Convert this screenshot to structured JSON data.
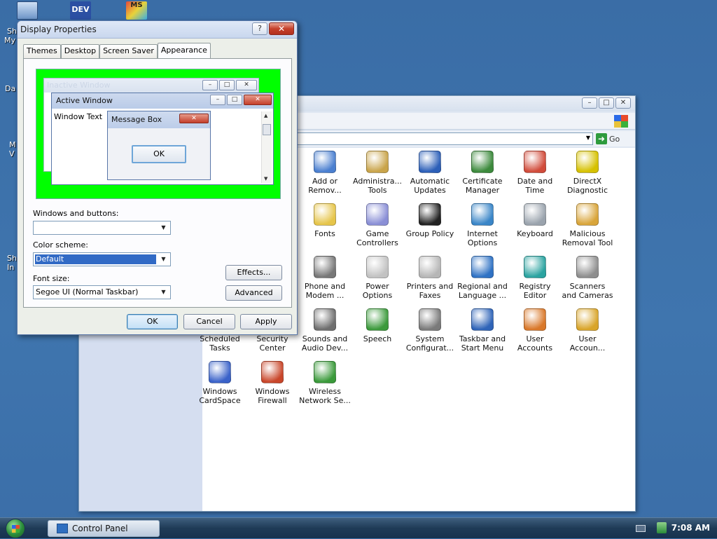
{
  "desktop": {
    "icon_labels": [
      "Sh",
      "My",
      "Da",
      "M",
      "V",
      "Sh",
      "In"
    ]
  },
  "control_panel": {
    "go_label": "Go",
    "items": [
      {
        "label": "Add or Remov...",
        "icon": "add-remove-programs-icon",
        "color": "#4a7fd0"
      },
      {
        "label": "Administra... Tools",
        "icon": "administrative-tools-icon",
        "color": "#c9a44a"
      },
      {
        "label": "Automatic Updates",
        "icon": "windows-flag-icon",
        "color": "#2c5fb8"
      },
      {
        "label": "Certificate Manager",
        "icon": "certificate-icon",
        "color": "#3c8a3c"
      },
      {
        "label": "Date and Time",
        "icon": "calendar-clock-icon",
        "color": "#d14b3a"
      },
      {
        "label": "DirectX Diagnostic",
        "icon": "directx-icon",
        "color": "#d6c100"
      },
      {
        "label": "Fonts",
        "icon": "fonts-folder-icon",
        "color": "#e6c54a"
      },
      {
        "label": "Game Controllers",
        "icon": "gamepad-icon",
        "color": "#8a8fd6"
      },
      {
        "label": "Group Policy",
        "icon": "users-group-icon",
        "color": "#222222"
      },
      {
        "label": "Internet Options",
        "icon": "globe-icon",
        "color": "#3a86c8"
      },
      {
        "label": "Keyboard",
        "icon": "keyboard-icon",
        "color": "#9aa3ad"
      },
      {
        "label": "Malicious Removal Tool",
        "icon": "removal-tool-icon",
        "color": "#d9a53a"
      },
      {
        "label": "Phone and Modem ...",
        "icon": "phone-icon",
        "color": "#777777"
      },
      {
        "label": "Power Options",
        "icon": "power-plug-icon",
        "color": "#c2c2c2"
      },
      {
        "label": "Printers and Faxes",
        "icon": "printer-icon",
        "color": "#b6b6b6"
      },
      {
        "label": "Regional and Language ...",
        "icon": "regional-globe-icon",
        "color": "#2f72c4"
      },
      {
        "label": "Registry Editor",
        "icon": "registry-cubes-icon",
        "color": "#2aa3a0"
      },
      {
        "label": "Scanners and Cameras",
        "icon": "scanner-camera-icon",
        "color": "#8e8e8e"
      },
      {
        "label": "Scheduled Tasks",
        "icon": "scheduled-tasks-icon",
        "color": "#e3b54a"
      },
      {
        "label": "Security Center",
        "icon": "security-shield-icon",
        "color": "#c93a2a"
      },
      {
        "label": "Sounds and Audio Dev...",
        "icon": "speaker-icon",
        "color": "#6e6e6e"
      },
      {
        "label": "Speech",
        "icon": "speech-icon",
        "color": "#3c9a3c"
      },
      {
        "label": "System Configurat...",
        "icon": "system-config-icon",
        "color": "#7a7a7a"
      },
      {
        "label": "Taskbar and Start Menu",
        "icon": "taskbar-icon",
        "color": "#2f64b8"
      },
      {
        "label": "User Accounts",
        "icon": "user-accounts-icon",
        "color": "#d9782a"
      },
      {
        "label": "User Accoun...",
        "icon": "user-key-icon",
        "color": "#d9a52a"
      },
      {
        "label": "Windows CardSpace",
        "icon": "cardspace-icon",
        "color": "#3a62c9"
      },
      {
        "label": "Windows Firewall",
        "icon": "firewall-icon",
        "color": "#c9462a"
      },
      {
        "label": "Wireless Network Se...",
        "icon": "wireless-icon",
        "color": "#3a9a3a"
      }
    ]
  },
  "dialog": {
    "title": "Display Properties",
    "help_label": "?",
    "close_label": "✕",
    "tabs": [
      "Themes",
      "Desktop",
      "Screen Saver",
      "Appearance"
    ],
    "active_tab": "Appearance",
    "preview": {
      "inactive_title": "Inactive Window",
      "active_title": "Active Window",
      "window_text": "Window Text",
      "message_box_title": "Message Box",
      "ok_label": "OK",
      "preview_bg": "#00ff00"
    },
    "windows_and_buttons_label": "Windows and buttons:",
    "windows_and_buttons_value": "",
    "color_scheme_label": "Color scheme:",
    "color_scheme_value": "Default",
    "font_size_label": "Font size:",
    "font_size_value": "Segoe UI (Normal Taskbar)",
    "effects_label": "Effects...",
    "advanced_label": "Advanced",
    "ok_label": "OK",
    "cancel_label": "Cancel",
    "apply_label": "Apply"
  },
  "taskbar": {
    "task_label": "Control Panel",
    "clock": "7:08 AM"
  }
}
